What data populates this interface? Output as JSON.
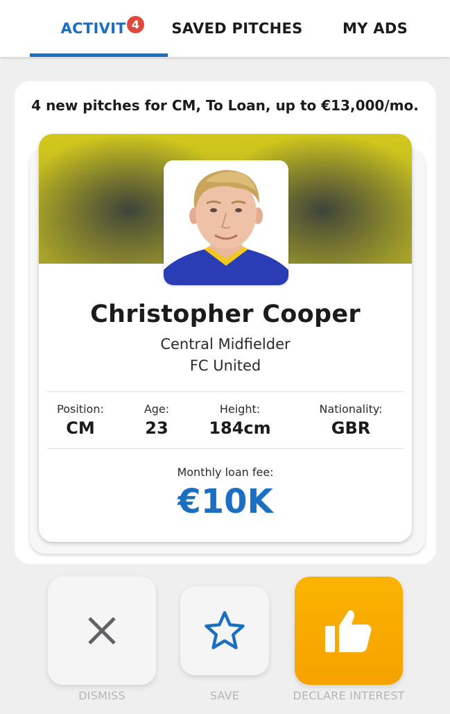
{
  "tabs": [
    {
      "label": "ACTIVITY",
      "active": true,
      "badge": "4"
    },
    {
      "label": "SAVED PITCHES",
      "active": false
    },
    {
      "label": "MY ADS",
      "active": false
    }
  ],
  "summary": "4 new pitches for CM, To Loan, up to €13,000/mo.",
  "player": {
    "name": "Christopher Cooper",
    "role": "Central Midfielder",
    "club": "FC United",
    "stats": [
      {
        "label": "Position:",
        "value": "CM"
      },
      {
        "label": "Age:",
        "value": "23"
      },
      {
        "label": "Height:",
        "value": "184cm"
      },
      {
        "label": "Nationality:",
        "value": "GBR"
      }
    ],
    "fee_label": "Monthly loan fee:",
    "fee_value": "€10K"
  },
  "actions": {
    "dismiss": {
      "label": "DISMISS",
      "icon": "close-icon"
    },
    "save": {
      "label": "SAVE",
      "icon": "star-icon"
    },
    "declare": {
      "label": "DECLARE INTEREST",
      "icon": "thumbs-up-icon"
    }
  },
  "colors": {
    "accent": "#1a6fc2",
    "badge": "#e0493a",
    "declare": "#f9ab00",
    "banner": "#cfc41e"
  }
}
